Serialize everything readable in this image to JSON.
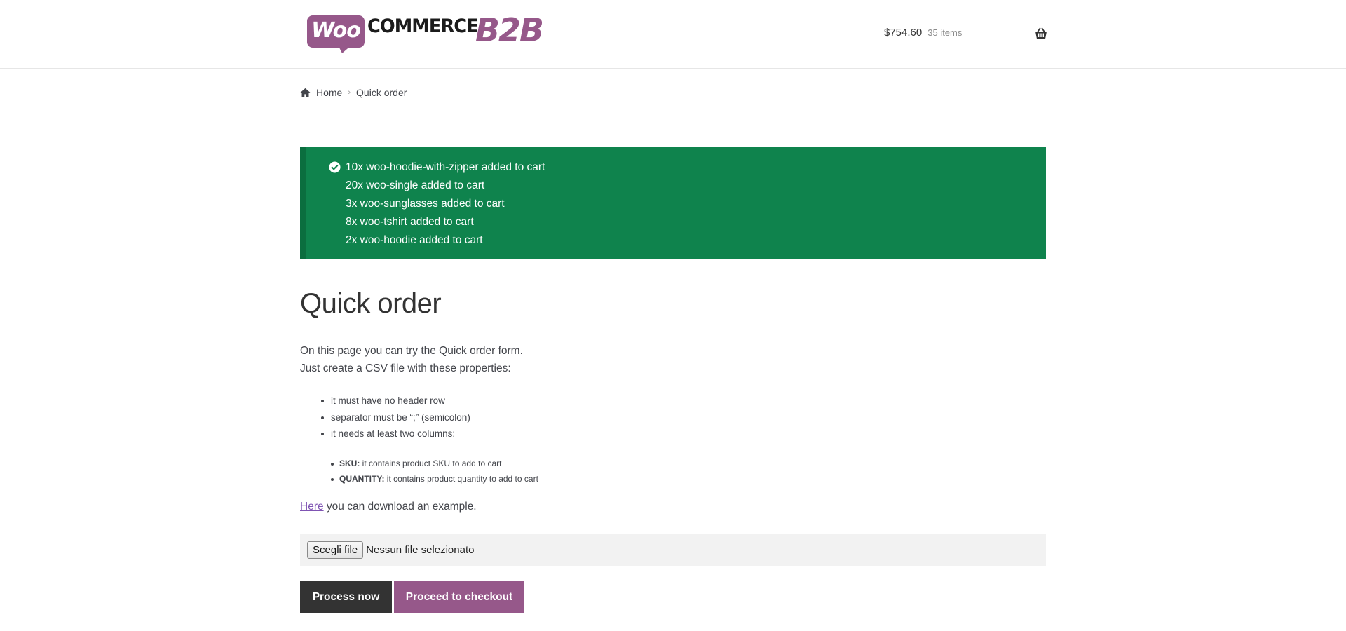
{
  "header": {
    "logo": {
      "woo": "Woo",
      "commerce": "COMMERCE",
      "b2b": "B2B"
    },
    "cart": {
      "amount": "$754.60",
      "count": "35 items",
      "icon": "basket-icon"
    }
  },
  "breadcrumb": {
    "home_icon": "home-icon",
    "home_label": "Home",
    "separator": "›",
    "current": "Quick order"
  },
  "notice": {
    "icon": "check-circle-icon",
    "messages": [
      "10x woo-hoodie-with-zipper added to cart",
      "20x woo-single added to cart",
      "3x woo-sunglasses added to cart",
      "8x woo-tshirt added to cart",
      "2x woo-hoodie added to cart"
    ],
    "color": "#0f834d"
  },
  "main": {
    "title": "Quick order",
    "intro_line1": "On this page you can try the Quick order form.",
    "intro_line2": "Just create a CSV file with these properties:",
    "requirements": [
      "it must have no header row",
      "separator must be “;” (semicolon)",
      "it needs at least two columns:"
    ],
    "columns": [
      {
        "name": "SKU:",
        "desc": " it contains product SKU to add to cart"
      },
      {
        "name": "QUANTITY:",
        "desc": " it contains product quantity to add to cart"
      }
    ],
    "example_link": "Here",
    "example_text": " you can download an example."
  },
  "file_input": {
    "button_label": "Scegli file",
    "status": "Nessun file selezionato"
  },
  "buttons": {
    "process": "Process now",
    "checkout": "Proceed to checkout"
  },
  "colors": {
    "brand_purple": "#96588a",
    "dark_button": "#333333",
    "success": "#0f834d"
  }
}
